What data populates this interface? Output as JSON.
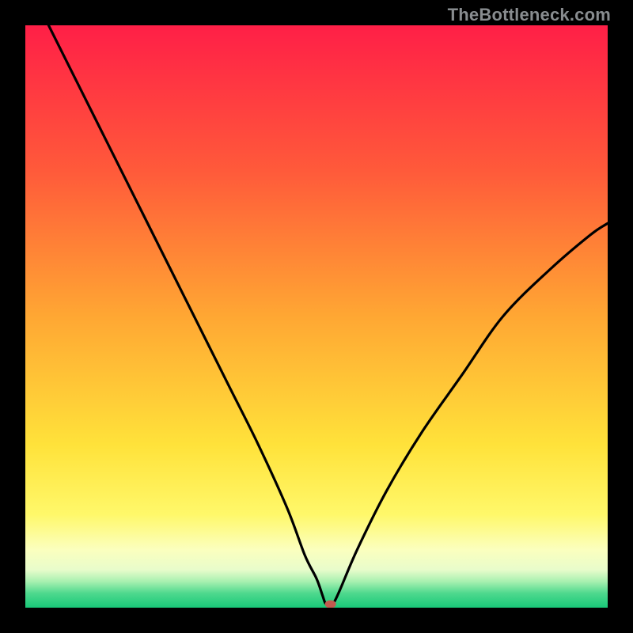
{
  "watermark": "TheBottleneck.com",
  "chart_data": {
    "type": "line",
    "title": "",
    "xlabel": "",
    "ylabel": "",
    "xlim": [
      0,
      100
    ],
    "ylim": [
      0,
      100
    ],
    "grid": false,
    "legend": false,
    "series": [
      {
        "name": "curve",
        "x": [
          4,
          10,
          15,
          20,
          25,
          30,
          35,
          40,
          45,
          48,
          50,
          51,
          51.5,
          52,
          52.8,
          54,
          57,
          62,
          68,
          75,
          82,
          90,
          97,
          100
        ],
        "y": [
          100,
          88,
          78,
          68,
          58,
          48,
          38,
          28,
          17,
          9,
          5,
          2.2,
          0.8,
          0.6,
          0.6,
          3,
          10,
          20,
          30,
          40,
          50,
          58,
          64,
          66
        ]
      }
    ],
    "marker": {
      "x": 52.4,
      "y": 0.6,
      "color": "#c25a4f",
      "rx": 7,
      "ry": 5
    },
    "gradient_stops": [
      {
        "offset": 0.0,
        "color": "#ff1f47"
      },
      {
        "offset": 0.25,
        "color": "#ff5a3a"
      },
      {
        "offset": 0.5,
        "color": "#ffa733"
      },
      {
        "offset": 0.72,
        "color": "#ffe23a"
      },
      {
        "offset": 0.84,
        "color": "#fff86a"
      },
      {
        "offset": 0.9,
        "color": "#fbffbe"
      },
      {
        "offset": 0.935,
        "color": "#e8fccb"
      },
      {
        "offset": 0.955,
        "color": "#a8f0b0"
      },
      {
        "offset": 0.975,
        "color": "#4fd98e"
      },
      {
        "offset": 1.0,
        "color": "#18c878"
      }
    ]
  }
}
